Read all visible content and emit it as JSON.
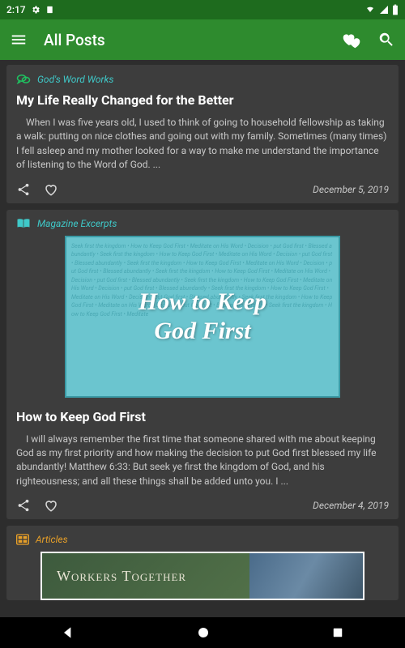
{
  "status_bar": {
    "time": "2:17",
    "icons": {
      "gear": "gear-icon",
      "doc": "doc-icon",
      "wifi": "wifi-icon",
      "signal": "signal-icon",
      "battery": "battery-icon"
    }
  },
  "app_bar": {
    "title": "All Posts",
    "menu": "menu-icon",
    "hearts": "hearts-icon",
    "search": "search-icon"
  },
  "posts": [
    {
      "category_icon": "speech-bubble-icon",
      "category_label": "God's Word Works",
      "title": "My Life Really Changed for the Better",
      "excerpt": "When I was five years old, I used to think of going to household fellowship as taking a walk: putting on nice clothes and going out with my family. Sometimes (many times) I fell asleep and my mother looked for a way to make me understand the importance of listening to the Word of God. ...",
      "date": "December 5, 2019"
    },
    {
      "category_icon": "book-open-icon",
      "category_label": "Magazine Excerpts",
      "hero_line1": "How to Keep",
      "hero_line2": "God First",
      "title": "How to Keep God First",
      "excerpt": "I will always remember the first time that someone shared with me about keeping God as my first priority and how making the decision to put God first blessed my life abundantly! Matthew 6:33: But seek ye first the kingdom of God, and his righteousness; and all these things shall be added unto you.     I ...",
      "date": "December 4, 2019"
    },
    {
      "category_icon": "grid-icon",
      "category_label": "Articles",
      "banner_text": "Workers Together"
    }
  ],
  "nav": {
    "back": "back-icon",
    "home": "home-icon",
    "recent": "recent-icon"
  }
}
